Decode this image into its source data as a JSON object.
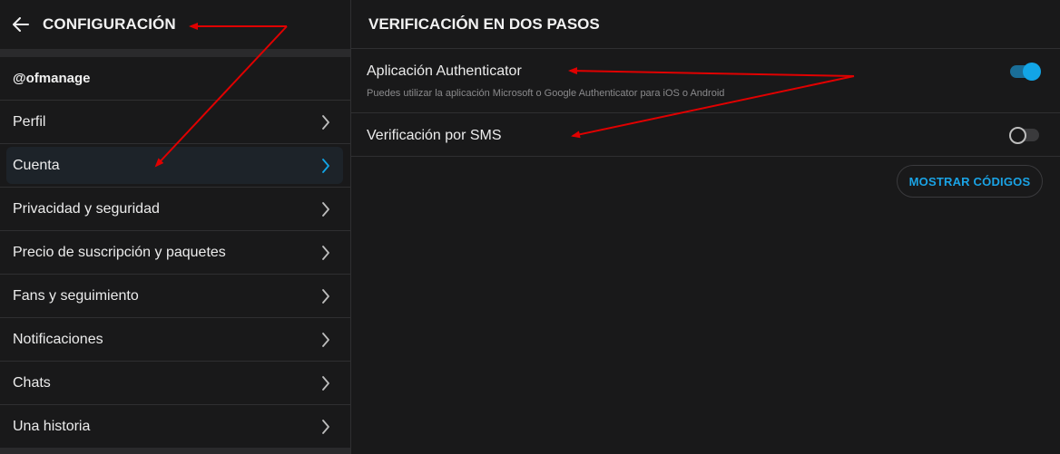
{
  "left": {
    "title": "CONFIGURACIÓN",
    "username": "@ofmanage",
    "items": [
      {
        "label": "Perfil"
      },
      {
        "label": "Cuenta"
      },
      {
        "label": "Privacidad y seguridad"
      },
      {
        "label": "Precio de suscripción y paquetes"
      },
      {
        "label": "Fans y seguimiento"
      },
      {
        "label": "Notificaciones"
      },
      {
        "label": "Chats"
      },
      {
        "label": "Una historia"
      }
    ],
    "active_item": "Cuenta"
  },
  "right": {
    "title": "VERIFICACIÓN EN DOS PASOS",
    "authenticator": {
      "label": "Aplicación Authenticator",
      "description": "Puedes utilizar la aplicación Microsoft o Google Authenticator para iOS o Android",
      "enabled": true
    },
    "sms": {
      "label": "Verificación por SMS",
      "enabled": false
    },
    "show_codes_label": "MOSTRAR CÓDIGOS"
  },
  "colors": {
    "background": "#19191a",
    "accent": "#12a5e6",
    "annotation_arrow": "#e00000"
  },
  "icons": {
    "back": "arrow-left-icon",
    "chevron": "chevron-right-icon"
  }
}
